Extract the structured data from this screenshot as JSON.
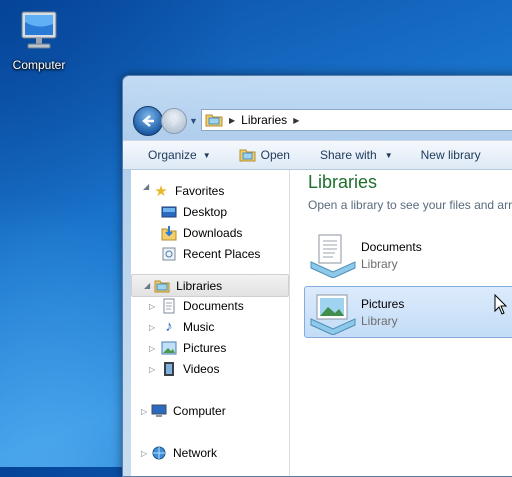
{
  "desktop": {
    "computer_icon_label": "Computer"
  },
  "address_bar": {
    "segments": [
      "Libraries"
    ]
  },
  "toolbar": {
    "organize": "Organize",
    "open": "Open",
    "share_with": "Share with",
    "new_library": "New library"
  },
  "nav_pane": {
    "favorites": "Favorites",
    "favorites_items": [
      "Desktop",
      "Downloads",
      "Recent Places"
    ],
    "libraries": "Libraries",
    "libraries_items": [
      "Documents",
      "Music",
      "Pictures",
      "Videos"
    ],
    "computer": "Computer",
    "network": "Network"
  },
  "content": {
    "title": "Libraries",
    "subtitle": "Open a library to see your files and arra",
    "items": [
      {
        "name": "Documents",
        "type": "Library"
      },
      {
        "name": "Pictures",
        "type": "Library"
      }
    ]
  },
  "colors": {
    "title_green": "#1e6e2e",
    "selection_blue": "#c3dcf7"
  }
}
